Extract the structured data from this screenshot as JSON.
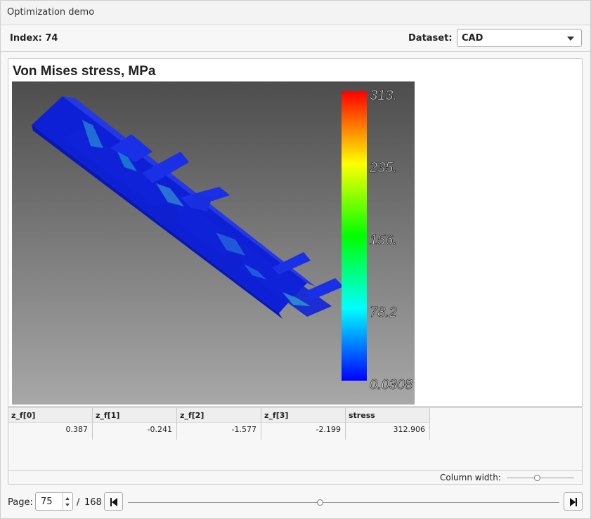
{
  "window": {
    "title": "Optimization demo"
  },
  "toolbar": {
    "index_label": "Index: 74",
    "dataset_label": "Dataset:",
    "dataset_value": "CAD"
  },
  "plot": {
    "title": "Von Mises stress, MPa",
    "colorbar_labels": [
      "313.",
      "235.",
      "156.",
      "78.2",
      "0.0308"
    ],
    "colorbar_range": [
      0.0308,
      313
    ],
    "colormap": [
      "#0000ff",
      "#00ffff",
      "#00ff00",
      "#ffff00",
      "#ff0000"
    ]
  },
  "table": {
    "columns": [
      "z_f[0]",
      "z_f[1]",
      "z_f[2]",
      "z_f[3]",
      "stress"
    ],
    "rows": [
      [
        "0.387",
        "-0.241",
        "-1.577",
        "-2.199",
        "312.906"
      ]
    ]
  },
  "column_width": {
    "label": "Column width:"
  },
  "pager": {
    "label": "Page:",
    "current": "75",
    "separator": "/",
    "total": "168"
  }
}
